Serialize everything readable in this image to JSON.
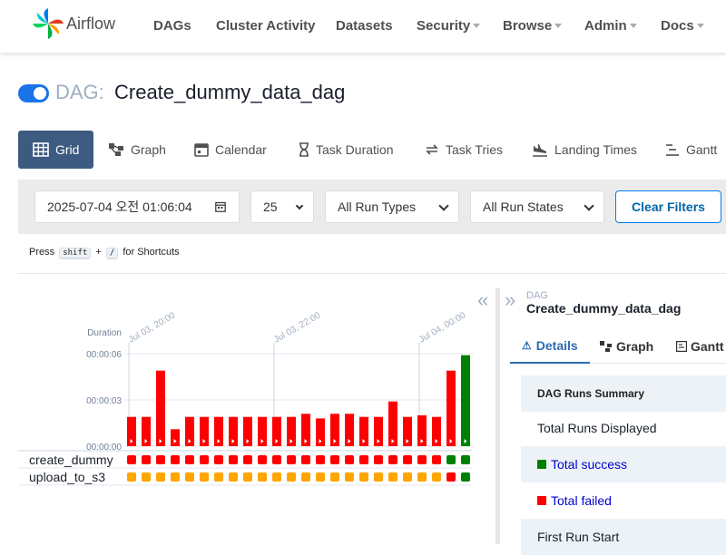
{
  "brand": {
    "name": "Airflow"
  },
  "nav": [
    {
      "label": "DAGs",
      "dropdown": false
    },
    {
      "label": "Cluster Activity",
      "dropdown": false
    },
    {
      "label": "Datasets",
      "dropdown": false
    },
    {
      "label": "Security",
      "dropdown": true
    },
    {
      "label": "Browse",
      "dropdown": true
    },
    {
      "label": "Admin",
      "dropdown": true
    },
    {
      "label": "Docs",
      "dropdown": true
    }
  ],
  "dag": {
    "prefix": "DAG:",
    "name": "Create_dummy_data_dag",
    "paused": false
  },
  "view_tabs": [
    {
      "label": "Grid",
      "icon": "grid-icon",
      "active": true
    },
    {
      "label": "Graph",
      "icon": "graph-icon",
      "active": false
    },
    {
      "label": "Calendar",
      "icon": "calendar-icon",
      "active": false
    },
    {
      "label": "Task Duration",
      "icon": "hourglass-icon",
      "active": false
    },
    {
      "label": "Task Tries",
      "icon": "retry-icon",
      "active": false
    },
    {
      "label": "Landing Times",
      "icon": "plane-icon",
      "active": false
    },
    {
      "label": "Gantt",
      "icon": "gantt-icon",
      "active": false
    }
  ],
  "filters": {
    "base_date": "2025-07-04 오전 01:06:04",
    "num_runs": "25",
    "run_type": "All Run Types",
    "run_state": "All Run States",
    "clear_label": "Clear Filters"
  },
  "shortcuts": {
    "prefix": "Press",
    "key1": "shift",
    "plus": "+",
    "key2": "/",
    "suffix": "for Shortcuts"
  },
  "grid": {
    "duration_label": "Duration",
    "duration_ticks": [
      "00:00:06",
      "00:00:03",
      "00:00:00"
    ],
    "date_labels": [
      "Jul 03, 20:00",
      "Jul 03, 22:00",
      "Jul 04, 00:00"
    ],
    "tasks": [
      {
        "name": "create_dummy"
      },
      {
        "name": "upload_to_s3"
      }
    ],
    "colors": {
      "failed": "#ff0000",
      "success": "#008000",
      "upstream_failed": "#ffa500"
    },
    "runs": [
      {
        "duration_s": 1.9,
        "state": "failed",
        "tasks": [
          "failed",
          "upstream_failed"
        ]
      },
      {
        "duration_s": 1.9,
        "state": "failed",
        "tasks": [
          "failed",
          "upstream_failed"
        ]
      },
      {
        "duration_s": 4.9,
        "state": "failed",
        "tasks": [
          "failed",
          "upstream_failed"
        ]
      },
      {
        "duration_s": 1.1,
        "state": "failed",
        "tasks": [
          "failed",
          "upstream_failed"
        ]
      },
      {
        "duration_s": 1.9,
        "state": "failed",
        "tasks": [
          "failed",
          "upstream_failed"
        ]
      },
      {
        "duration_s": 1.9,
        "state": "failed",
        "tasks": [
          "failed",
          "upstream_failed"
        ]
      },
      {
        "duration_s": 1.9,
        "state": "failed",
        "tasks": [
          "failed",
          "upstream_failed"
        ]
      },
      {
        "duration_s": 1.9,
        "state": "failed",
        "tasks": [
          "failed",
          "upstream_failed"
        ]
      },
      {
        "duration_s": 1.9,
        "state": "failed",
        "tasks": [
          "failed",
          "upstream_failed"
        ]
      },
      {
        "duration_s": 1.9,
        "state": "failed",
        "tasks": [
          "failed",
          "upstream_failed"
        ]
      },
      {
        "duration_s": 1.9,
        "state": "failed",
        "tasks": [
          "failed",
          "upstream_failed"
        ]
      },
      {
        "duration_s": 1.9,
        "state": "failed",
        "tasks": [
          "failed",
          "upstream_failed"
        ]
      },
      {
        "duration_s": 2.1,
        "state": "failed",
        "tasks": [
          "failed",
          "upstream_failed"
        ]
      },
      {
        "duration_s": 1.8,
        "state": "failed",
        "tasks": [
          "failed",
          "upstream_failed"
        ]
      },
      {
        "duration_s": 2.1,
        "state": "failed",
        "tasks": [
          "failed",
          "upstream_failed"
        ]
      },
      {
        "duration_s": 2.1,
        "state": "failed",
        "tasks": [
          "failed",
          "upstream_failed"
        ]
      },
      {
        "duration_s": 1.9,
        "state": "failed",
        "tasks": [
          "failed",
          "upstream_failed"
        ]
      },
      {
        "duration_s": 1.9,
        "state": "failed",
        "tasks": [
          "failed",
          "upstream_failed"
        ]
      },
      {
        "duration_s": 2.9,
        "state": "failed",
        "tasks": [
          "failed",
          "upstream_failed"
        ]
      },
      {
        "duration_s": 1.9,
        "state": "failed",
        "tasks": [
          "failed",
          "upstream_failed"
        ]
      },
      {
        "duration_s": 2.0,
        "state": "failed",
        "tasks": [
          "failed",
          "upstream_failed"
        ]
      },
      {
        "duration_s": 1.9,
        "state": "failed",
        "tasks": [
          "failed",
          "upstream_failed"
        ]
      },
      {
        "duration_s": 4.9,
        "state": "failed",
        "tasks": [
          "success",
          "failed"
        ]
      },
      {
        "duration_s": 5.9,
        "state": "success",
        "tasks": [
          "success",
          "success"
        ]
      }
    ]
  },
  "details": {
    "dag_label": "DAG",
    "dag_name": "Create_dummy_data_dag",
    "tabs": [
      {
        "label": "Details",
        "icon": "warning-icon",
        "active": true
      },
      {
        "label": "Graph",
        "icon": "graph-icon",
        "active": false
      },
      {
        "label": "Gantt",
        "icon": "gantt-icon",
        "active": false
      }
    ],
    "summary_header": "DAG Runs Summary",
    "total_runs": "Total Runs Displayed",
    "total_success": "Total success",
    "total_failed": "Total failed",
    "first_run": "First Run Start"
  }
}
